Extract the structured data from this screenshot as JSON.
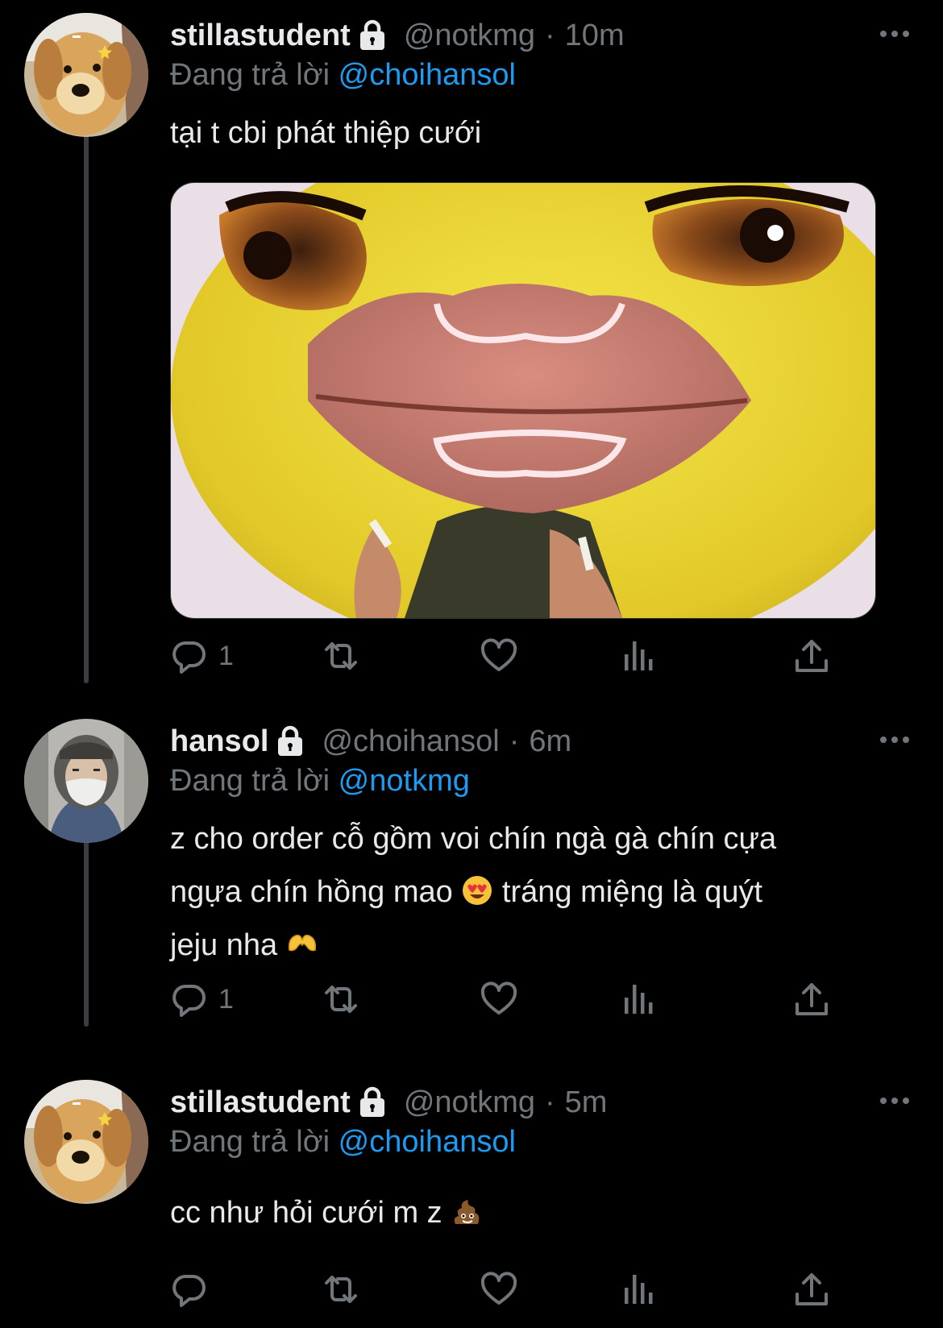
{
  "tweets": [
    {
      "name": "stillastudent",
      "handle": "@notkmg",
      "separator": "·",
      "time": "10m",
      "replying_prefix": "Đang trả lời",
      "replying_to": "@choihansol",
      "text": "tại t cbi phát thiệp cưới",
      "reply_count": "1",
      "avatar": "golden-retriever-puppy",
      "media": "yellow-cartoon-face-with-big-pink-lips"
    },
    {
      "name": "hansol",
      "handle": "@choihansol",
      "separator": "·",
      "time": "6m",
      "replying_prefix": "Đang trả lời",
      "replying_to": "@notkmg",
      "text_line1": "z cho order cỗ gồm voi chín ngà gà chín cựa",
      "text_line2a": "ngựa chín hồng mao",
      "text_line2b": "tráng miệng là quýt",
      "text_line3": "jeju nha",
      "reply_count": "1",
      "avatar": "person-in-hood-and-mask",
      "emoji_1": "heart-eyes-emoji",
      "emoji_2": "heart-hands-emoji"
    },
    {
      "name": "stillastudent",
      "handle": "@notkmg",
      "separator": "·",
      "time": "5m",
      "replying_prefix": "Đang trả lời",
      "replying_to": "@choihansol",
      "text": "cc như hỏi cưới m z",
      "reply_count": "",
      "avatar": "golden-retriever-puppy",
      "emoji_1": "poop-emoji"
    }
  ],
  "colors": {
    "background": "#000000",
    "text_primary": "#e7e9ea",
    "text_secondary": "#71767b",
    "accent": "#1d9bf0",
    "thread_line": "#3a3d41"
  },
  "icons": [
    "lock-icon",
    "more-icon",
    "reply-icon",
    "retweet-icon",
    "like-icon",
    "views-icon",
    "share-icon"
  ]
}
